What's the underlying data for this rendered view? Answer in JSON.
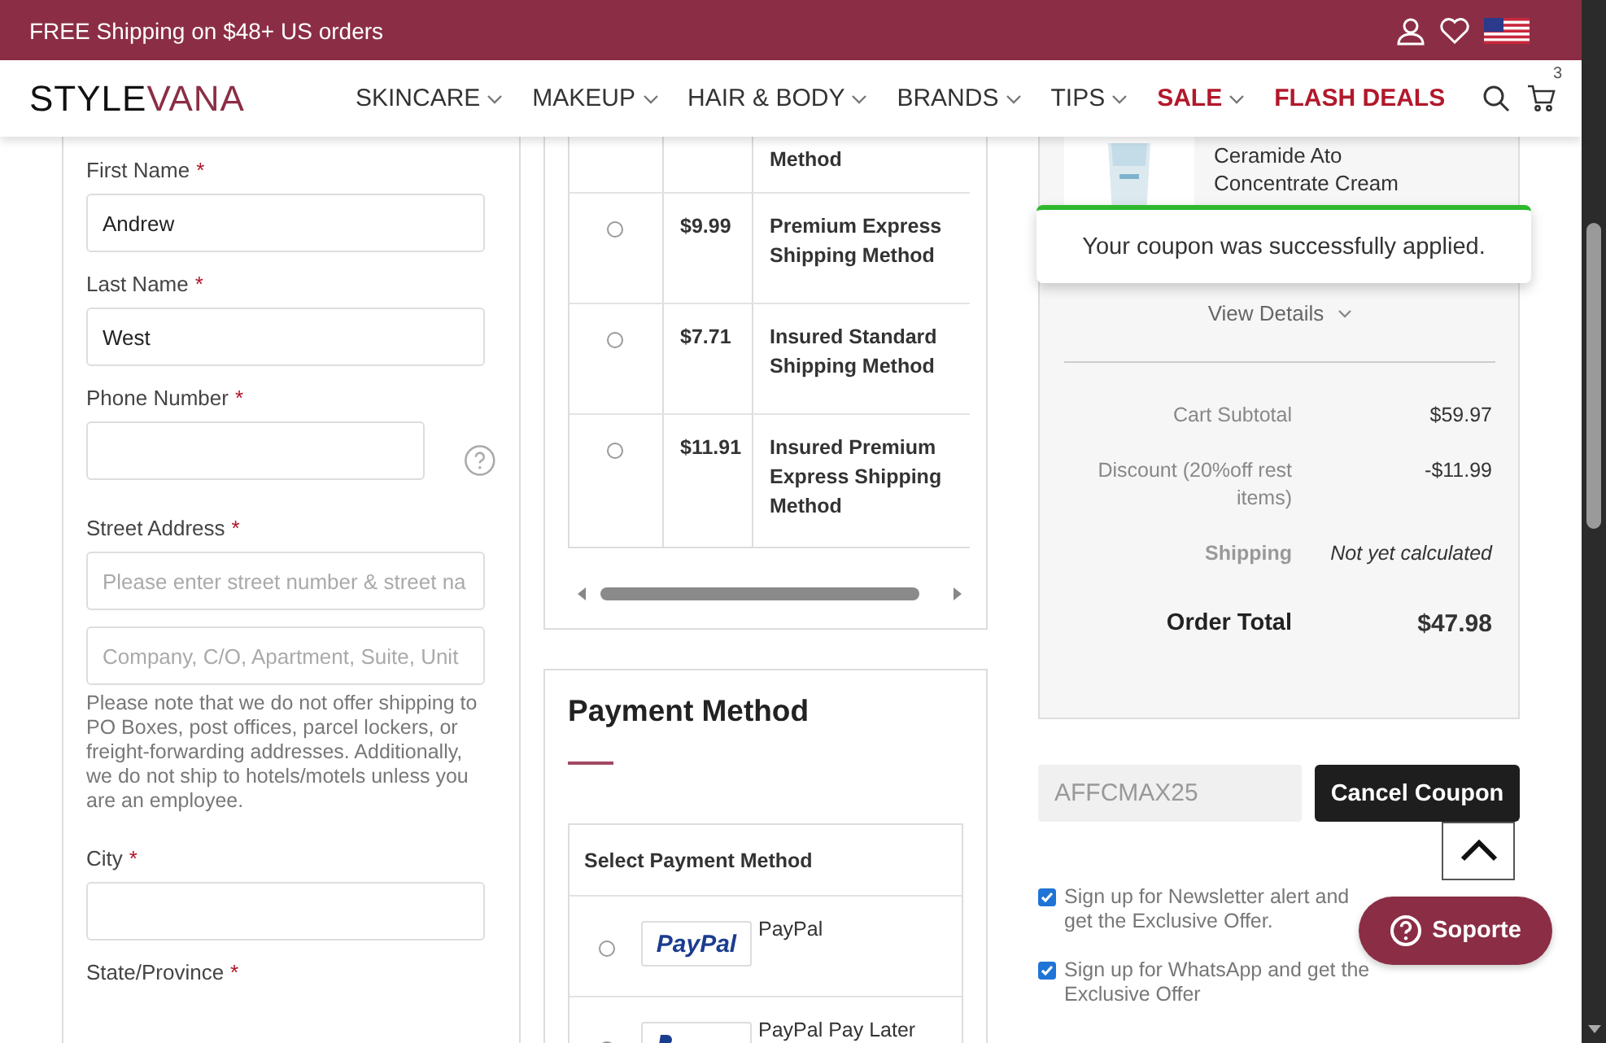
{
  "promo_bar": {
    "text": "FREE Shipping on $48+ US orders"
  },
  "header": {
    "logo": [
      "STYLE",
      "VANA"
    ],
    "nav": [
      {
        "label": "SKINCARE",
        "kind": "dropdown",
        "highlight": false
      },
      {
        "label": "MAKEUP",
        "kind": "dropdown",
        "highlight": false
      },
      {
        "label": "HAIR & BODY",
        "kind": "dropdown",
        "highlight": false
      },
      {
        "label": "BRANDS",
        "kind": "dropdown",
        "highlight": false
      },
      {
        "label": "TIPS",
        "kind": "dropdown",
        "highlight": false
      },
      {
        "label": "SALE",
        "kind": "dropdown",
        "highlight": true
      },
      {
        "label": "FLASH DEALS",
        "kind": "link",
        "highlight": true
      }
    ],
    "cart_count": "3"
  },
  "address_form": {
    "required_mark": "*",
    "items": [
      {
        "kind": "field",
        "label": "First Name",
        "required": true,
        "value": "Andrew"
      },
      {
        "kind": "field",
        "label": "Last Name",
        "required": true,
        "value": "West"
      },
      {
        "kind": "phone",
        "label": "Phone Number",
        "required": true
      },
      {
        "kind": "field",
        "label": "Street Address",
        "required": true,
        "placeholder": "Please enter street number & street na"
      },
      {
        "kind": "input",
        "placeholder": "Company, C/O, Apartment, Suite, Unit"
      },
      {
        "kind": "note",
        "text": "Please note that we do not offer shipping to PO Boxes, post offices, parcel lockers, or freight-forwarding addresses. Additionally, we do not ship to hotels/motels unless you are an employee."
      },
      {
        "kind": "field",
        "label": "City",
        "required": true
      },
      {
        "kind": "label",
        "label": "State/Province",
        "required": true
      }
    ]
  },
  "shipping": {
    "rows": [
      {
        "kind": "partial",
        "name": "Method"
      },
      {
        "kind": "option",
        "price": "$9.99",
        "name": "Premium Express Shipping Method",
        "selected": false
      },
      {
        "kind": "option",
        "price": "$7.71",
        "name": "Insured Standard Shipping Method",
        "selected": false
      },
      {
        "kind": "option",
        "price": "$11.91",
        "name": "Insured Premium Express Shipping Method",
        "selected": false
      }
    ]
  },
  "payment": {
    "title": "Payment Method",
    "table_header": "Select Payment Method",
    "options": [
      {
        "label": "PayPal",
        "logo": "PayPal",
        "selected": false
      },
      {
        "label": "PayPal Pay Later",
        "selected": false
      }
    ]
  },
  "summary": {
    "product": {
      "name": "Ceramide Ato Concentrate Cream"
    },
    "toast": "Your coupon was successfully applied.",
    "view_details": "View Details",
    "totals": [
      {
        "kind": "normal",
        "label": "Cart Subtotal",
        "value": "$59.97"
      },
      {
        "kind": "normal",
        "label": "Discount (20%off rest items)",
        "value": "-$11.99"
      },
      {
        "kind": "pending",
        "label": "Shipping",
        "value": "Not yet calculated"
      },
      {
        "kind": "total",
        "label": "Order Total",
        "value": "$47.98"
      }
    ]
  },
  "coupon": {
    "value": "AFFCMAX25",
    "button": "Cancel Coupon"
  },
  "signups": [
    {
      "label": "Sign up for Newsletter alert and get the Exclusive Offer.",
      "checked": true
    },
    {
      "label": "Sign up for WhatsApp and get the Exclusive Offer",
      "checked": true
    }
  ],
  "support_button": "Soporte"
}
